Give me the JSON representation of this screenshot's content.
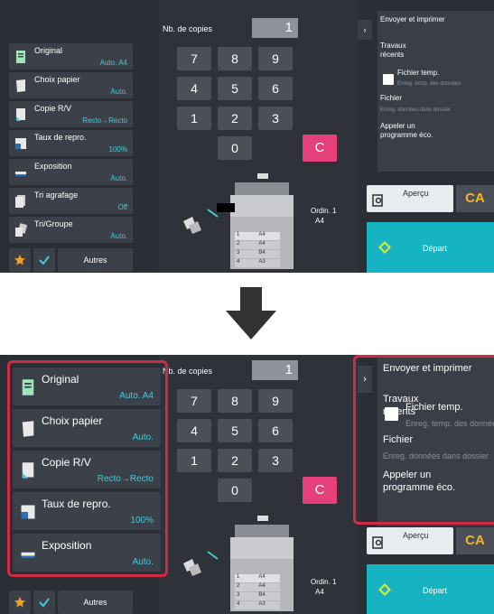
{
  "screen": {
    "copies_label": "Nb. de copies",
    "copies_value": "1",
    "keys": [
      "7",
      "8",
      "9",
      "4",
      "5",
      "6",
      "1",
      "2",
      "3",
      "0"
    ],
    "clear_key": "C",
    "menu": [
      {
        "label": "Original",
        "value": "Auto. A4",
        "icon": "original-icon"
      },
      {
        "label": "Choix papier",
        "value": "Auto.",
        "icon": "paper-icon"
      },
      {
        "label": "Copie R/V",
        "value": "Recto→Recto",
        "icon": "duplex-icon"
      },
      {
        "label": "Taux de repro.",
        "value": "100%",
        "icon": "ratio-icon"
      },
      {
        "label": "Exposition",
        "value": "Auto.",
        "icon": "exposure-icon"
      },
      {
        "label": "Tri agrafage",
        "value": "Off",
        "icon": "staple-icon"
      },
      {
        "label": "Tri/Groupe",
        "value": "Auto.",
        "icon": "sort-icon"
      }
    ],
    "bottom": {
      "others_label": "Autres"
    },
    "right_panel": {
      "send_print": "Envoyer et imprimer",
      "recent_jobs_line1": "Travaux",
      "recent_jobs_line2": "récents",
      "temp_file": "Fichier temp.",
      "temp_file_sub": "Enreg. temp. des données",
      "file": "Fichier",
      "file_sub": "Enreg. données dans dossier",
      "eco_line1": "Appeler un",
      "eco_line2": "programme éco."
    },
    "preview_label": "Aperçu",
    "ca_label": "CA",
    "start_label": "Départ",
    "tray": {
      "name": "Ordin. 1",
      "size": "A4"
    },
    "trays": [
      {
        "num": "1",
        "size": "A4"
      },
      {
        "num": "2",
        "size": "A4"
      },
      {
        "num": "3",
        "size": "B4"
      },
      {
        "num": "4",
        "size": "A3"
      }
    ],
    "colors": {
      "accent": "#47c9d6",
      "clear": "#e5407a",
      "start": "#16b3c3",
      "highlight": "#d02a46",
      "ca": "#f2b42b"
    }
  }
}
